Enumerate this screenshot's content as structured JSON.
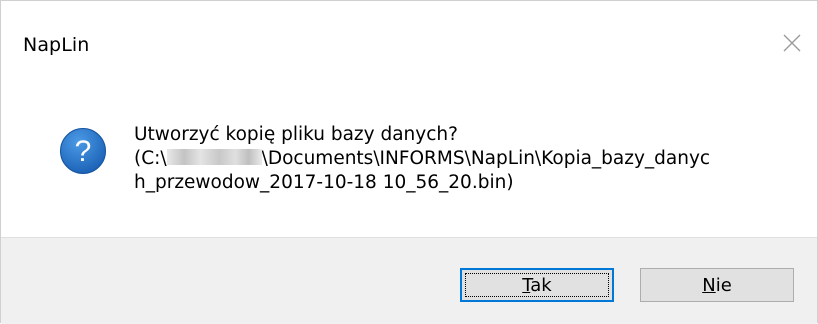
{
  "window": {
    "title": "NapLin",
    "close_icon": "close-icon"
  },
  "message": {
    "icon": "question-icon",
    "line1": "Utworzyć kopię pliku bazy danych?",
    "line2_prefix": "(C:\\",
    "line2_suffix": "\\Documents\\INFORMS\\NapLin\\Kopia_bazy_danyc",
    "line3": "h_przewodow_2017-10-18 10_56_20.bin)"
  },
  "buttons": {
    "yes": {
      "accelerator": "T",
      "rest": "ak"
    },
    "no": {
      "accelerator": "N",
      "rest": "ie"
    }
  },
  "colors": {
    "accent": "#0078d7",
    "icon_blue": "#1f6fc6",
    "footer_bg": "#f0f0f0"
  }
}
